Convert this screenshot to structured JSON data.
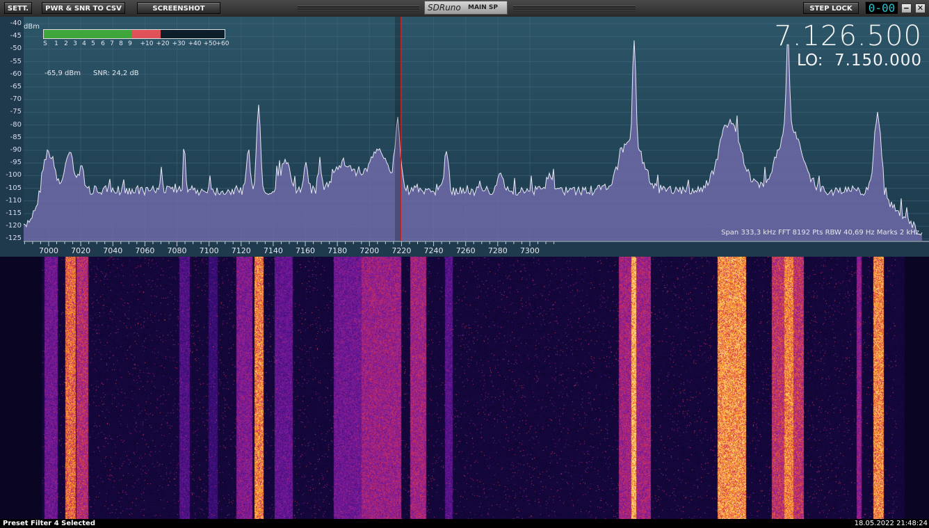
{
  "toolbar": {
    "sett_label": "SETT.",
    "pwr_snr_label": "PWR & SNR TO CSV",
    "screenshot_label": "SCREENSHOT",
    "app_logo": "SDRuno",
    "window_name": "MAIN SP",
    "step_lock_label": "STEP LOCK",
    "digit_display": "0-00",
    "minimize_glyph": "‒",
    "close_glyph": "✕"
  },
  "spectrum": {
    "y_unit": "dBm",
    "y_ticks": [
      "-40",
      "-45",
      "-50",
      "-55",
      "-60",
      "-65",
      "-70",
      "-75",
      "-80",
      "-85",
      "-90",
      "-95",
      "-100",
      "-105",
      "-110",
      "-115",
      "-120",
      "-125"
    ],
    "x_ticks": [
      "7000",
      "7020",
      "7040",
      "7060",
      "7080",
      "7100",
      "7120",
      "7140",
      "7160",
      "7180",
      "7200",
      "7220",
      "7240",
      "7260",
      "7280",
      "7300"
    ],
    "smeter_ticks": [
      "S",
      "1",
      "2",
      "3",
      "4",
      "5",
      "6",
      "7",
      "8",
      "9",
      "+10",
      "+20",
      "+30",
      "+40",
      "+50",
      "+60"
    ],
    "smeter_fraction_green": 0.48,
    "smeter_fraction_red": 0.16,
    "level_readout": "-65,9 dBm",
    "snr_readout": "SNR: 24,2 dB",
    "tuned_frequency": "7.126.500",
    "lo_label": "LO:",
    "lo_frequency": "7.150.000",
    "status_line": "Span 333,3 kHz   FFT 8192 Pts   RBW 40,69 Hz   Marks 2 kHz",
    "colors": {
      "background_top": "#2c5668",
      "background_bottom": "#1c3a4c",
      "fill": "#6f6aa8",
      "trace": "#e8e8f4",
      "cursor": "#c02020",
      "grid": "#4a6a86"
    }
  },
  "waterfall": {
    "colors": [
      "#05041a",
      "#2a0b6a",
      "#7a1aa0",
      "#d0305a",
      "#ff9a1a",
      "#ffe08a"
    ]
  },
  "statusbar": {
    "preset_text": "Preset Filter 4 Selected",
    "datetime": "18.05.2022 21:48:24"
  }
}
